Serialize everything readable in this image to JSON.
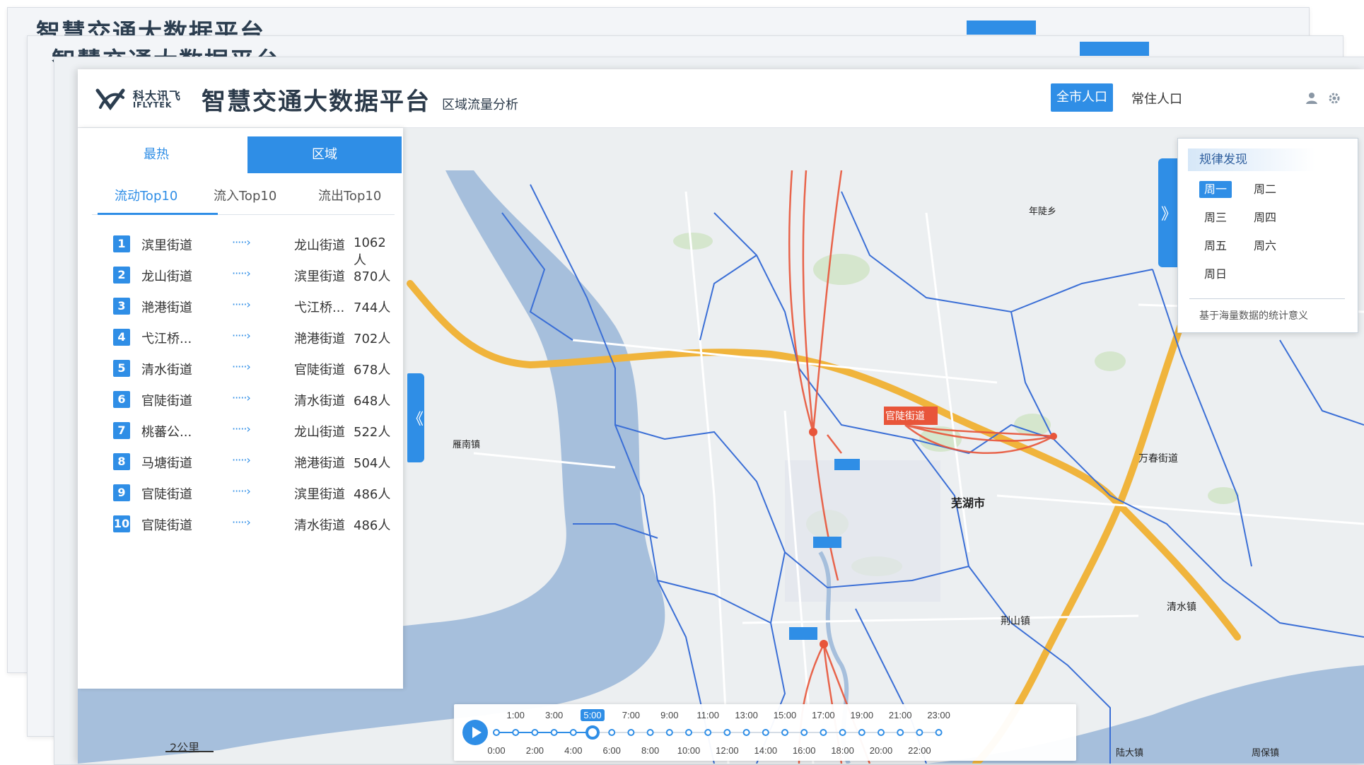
{
  "background_windows": [
    {
      "title": "智慧交通大数据平台"
    },
    {
      "title": "智慧交通大数据平台"
    }
  ],
  "header": {
    "logo_cn": "科大讯飞",
    "logo_en": "IFLYTEK",
    "title": "智慧交通大数据平台",
    "subtitle": "区域流量分析",
    "buttons": {
      "all_population": "全市人口",
      "resident_population": "常住人口"
    },
    "accent_color": "#2f8ee6"
  },
  "left_panel": {
    "tabs": [
      "最热",
      "区域"
    ],
    "active_tab": "区域",
    "sub_tabs": [
      "流动Top10",
      "流入Top10",
      "流出Top10"
    ],
    "active_sub_tab": "流动Top10",
    "arrow_glyph": "·····›",
    "rows": [
      {
        "rank": "1",
        "from": "滨里街道",
        "to": "龙山街道",
        "count": "1062人"
      },
      {
        "rank": "2",
        "from": "龙山街道",
        "to": "滨里街道",
        "count": "870人"
      },
      {
        "rank": "3",
        "from": "滟港街道",
        "to": "弋江桥...",
        "count": "744人"
      },
      {
        "rank": "4",
        "from": "弋江桥...",
        "to": "滟港街道",
        "count": "702人"
      },
      {
        "rank": "5",
        "from": "清水街道",
        "to": "官陡街道",
        "count": "678人"
      },
      {
        "rank": "6",
        "from": "官陡街道",
        "to": "清水街道",
        "count": "648人"
      },
      {
        "rank": "7",
        "from": "桃蕃公...",
        "to": "龙山街道",
        "count": "522人"
      },
      {
        "rank": "8",
        "from": "马塘街道",
        "to": "滟港街道",
        "count": "504人"
      },
      {
        "rank": "9",
        "from": "官陡街道",
        "to": "滨里街道",
        "count": "486人"
      },
      {
        "rank": "10",
        "from": "官陡街道",
        "to": "清水街道",
        "count": "486人"
      }
    ]
  },
  "rule_panel": {
    "title": "规律发现",
    "days": [
      "周一",
      "周二",
      "周三",
      "周四",
      "周五",
      "周六",
      "周日"
    ],
    "active_day": "周一",
    "note": "基于海量数据的统计意义"
  },
  "map": {
    "labels": {
      "city": "芜湖市",
      "highlight": "官陡街道",
      "wanchun": "万春街道",
      "qingshui": "清水镇",
      "jingshan": "荆山镇",
      "yannan": "雁南镇",
      "nianli": "年陡乡",
      "lucun": "陆大镇",
      "zhoubao": "周保镇"
    },
    "scale": "2公里",
    "flow_color": "#e8553a",
    "water_color": "#a6bfdc",
    "highway_color": "#f0b43c"
  },
  "timeline": {
    "top_labels": [
      "1:00",
      "3:00",
      "5:00",
      "7:00",
      "9:00",
      "11:00",
      "13:00",
      "15:00",
      "17:00",
      "19:00",
      "21:00",
      "23:00"
    ],
    "bottom_labels": [
      "0:00",
      "2:00",
      "4:00",
      "6:00",
      "8:00",
      "10:00",
      "12:00",
      "14:00",
      "16:00",
      "18:00",
      "20:00",
      "22:00"
    ],
    "current": "5:00"
  }
}
